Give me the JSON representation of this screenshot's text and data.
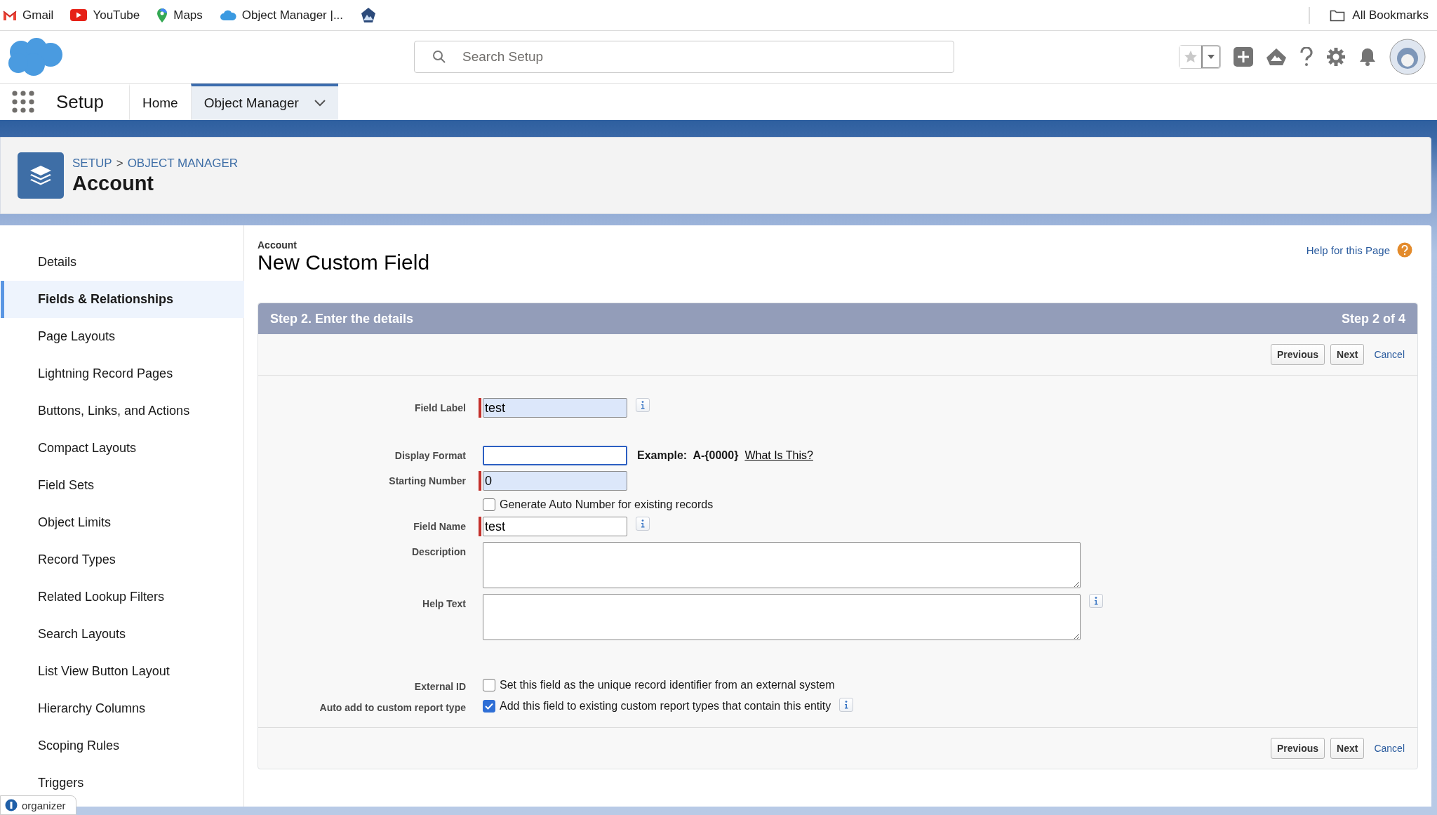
{
  "bookmarks": [
    {
      "kind": "gmail",
      "label": "Gmail"
    },
    {
      "kind": "youtube",
      "label": "YouTube"
    },
    {
      "kind": "maps",
      "label": "Maps"
    },
    {
      "kind": "cloud",
      "label": "Object Manager |..."
    },
    {
      "kind": "mountain"
    }
  ],
  "all_bookmarks": "All Bookmarks",
  "header": {
    "search_placeholder": "Search Setup"
  },
  "nav": {
    "app_name": "Setup",
    "tabs": [
      {
        "label": "Home",
        "selected": false,
        "has_menu": false
      },
      {
        "label": "Object Manager",
        "selected": true,
        "has_menu": true
      }
    ]
  },
  "page_header": {
    "breadcrumbs": [
      "SETUP",
      "OBJECT MANAGER"
    ],
    "separator": ">",
    "title": "Account"
  },
  "sidebar": {
    "items": [
      {
        "label": "Details",
        "selected": false
      },
      {
        "label": "Fields & Relationships",
        "selected": true
      },
      {
        "label": "Page Layouts",
        "selected": false
      },
      {
        "label": "Lightning Record Pages",
        "selected": false
      },
      {
        "label": "Buttons, Links, and Actions",
        "selected": false
      },
      {
        "label": "Compact Layouts",
        "selected": false
      },
      {
        "label": "Field Sets",
        "selected": false
      },
      {
        "label": "Object Limits",
        "selected": false
      },
      {
        "label": "Record Types",
        "selected": false
      },
      {
        "label": "Related Lookup Filters",
        "selected": false
      },
      {
        "label": "Search Layouts",
        "selected": false
      },
      {
        "label": "List View Button Layout",
        "selected": false
      },
      {
        "label": "Hierarchy Columns",
        "selected": false
      },
      {
        "label": "Scoping Rules",
        "selected": false
      },
      {
        "label": "Triggers",
        "selected": false
      }
    ]
  },
  "content": {
    "object_label": "Account",
    "title": "New Custom Field",
    "help_link": "Help for this Page",
    "step_title": "Step 2. Enter the details",
    "step_counter": "Step 2 of 4",
    "buttons_top": {
      "previous": "Previous",
      "next": "Next",
      "cancel": "Cancel"
    },
    "fields": [
      {
        "kind": "text",
        "label": "Field Label",
        "value": "test",
        "required": true,
        "highlighted": true,
        "focused": false,
        "info": true
      },
      {
        "kind": "text",
        "label": "Display Format",
        "required": false,
        "highlighted": false,
        "focused": true,
        "info": false,
        "example_label": "Example:",
        "example_value": "A-{0000}",
        "link": "What Is This?"
      },
      {
        "kind": "text",
        "label": "Starting Number",
        "value": "0",
        "required": true,
        "highlighted": true,
        "focused": false,
        "info": false
      },
      {
        "kind": "checkbox",
        "text": "Generate Auto Number for existing records",
        "checked": false,
        "info": false
      },
      {
        "kind": "text",
        "label": "Field Name",
        "value": "test",
        "required": true,
        "highlighted": false,
        "focused": false,
        "info": true
      },
      {
        "kind": "textarea",
        "label": "Description",
        "info": false
      },
      {
        "kind": "textarea",
        "label": "Help Text",
        "info": true
      },
      {
        "kind": "checkbox",
        "label": "External ID",
        "text": "Set this field as the unique record identifier from an external system",
        "checked": false,
        "info": false
      },
      {
        "kind": "checkbox",
        "label": "Auto add to custom report type",
        "text": "Add this field to existing custom report types that contain this entity",
        "checked": true,
        "info": true
      }
    ],
    "buttons_bottom": {
      "previous": "Previous",
      "next": "Next",
      "cancel": "Cancel"
    }
  },
  "organizer": "organizer"
}
